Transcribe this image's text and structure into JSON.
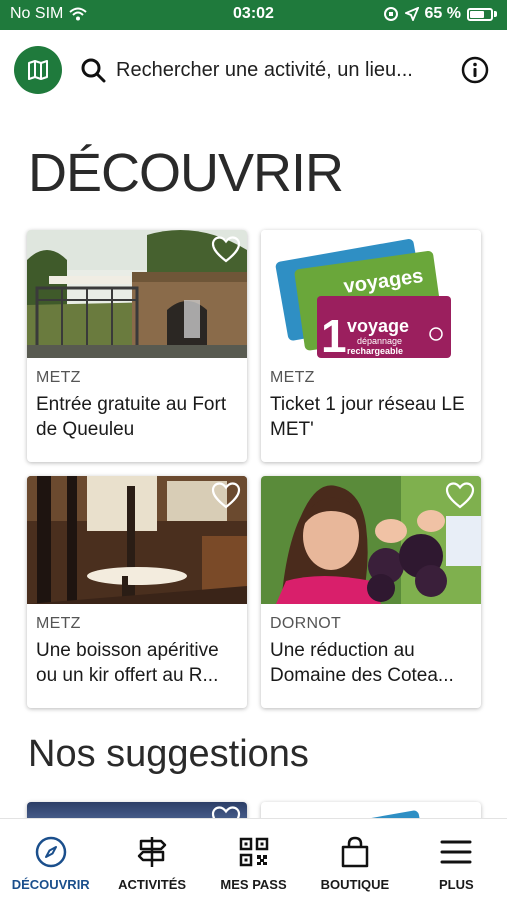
{
  "status_bar": {
    "carrier": "No SIM",
    "time": "03:02",
    "battery": "65 %",
    "battery_level": 0.65
  },
  "header": {
    "map_icon": "map-icon",
    "search_icon": "search-icon",
    "search_placeholder": "Rechercher une activité, un lieu...",
    "info_icon": "info-icon"
  },
  "discover": {
    "title": "DÉCOUVRIR",
    "cards": [
      {
        "city": "METZ",
        "title": "Entrée gratuite au Fort de Queuleu"
      },
      {
        "city": "METZ",
        "title": "Ticket 1 jour réseau LE MET'"
      },
      {
        "city": "METZ",
        "title": "Une boisson apéritive ou un kir offert au R..."
      },
      {
        "city": "DORNOT",
        "title": "Une réduction au Domaine des Cotea..."
      }
    ]
  },
  "tickets_image": {
    "voyages_label": "voyages",
    "voyage_label": "voyage",
    "big_number": "1",
    "depannage": "dépannage",
    "rechargeable": "rechargeable"
  },
  "suggestions": {
    "title": "Nos suggestions"
  },
  "tabbar": {
    "active_color": "#1b4f8c",
    "items": [
      {
        "label": "DÉCOUVRIR",
        "icon": "compass-icon"
      },
      {
        "label": "ACTIVITÉS",
        "icon": "signpost-icon"
      },
      {
        "label": "MES PASS",
        "icon": "qr-code-icon"
      },
      {
        "label": "BOUTIQUE",
        "icon": "shopping-bag-icon"
      },
      {
        "label": "PLUS",
        "icon": "menu-icon"
      }
    ]
  },
  "colors": {
    "brand_green": "#1f7a3c",
    "wine_red": "#9b1f5e",
    "ticket_green": "#6aa73a",
    "ticket_blue": "#2f8fc4"
  }
}
